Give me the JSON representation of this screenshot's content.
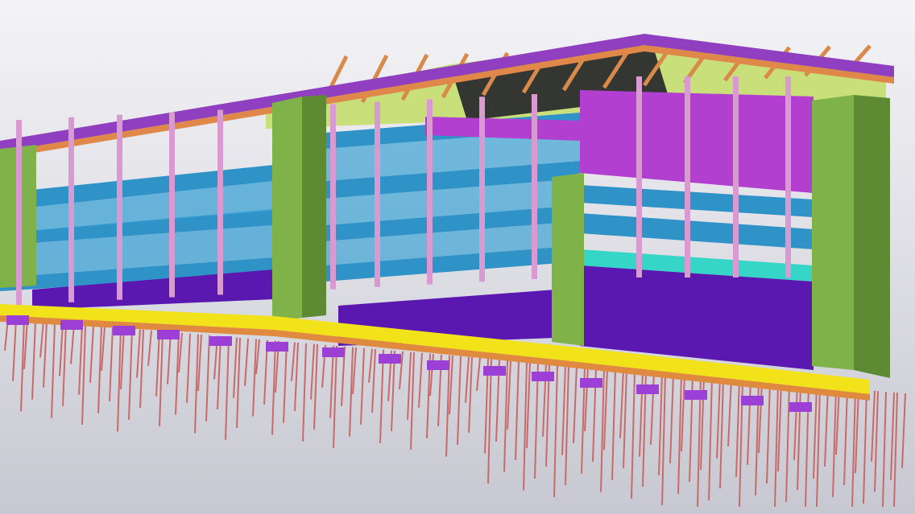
{
  "scene": {
    "subject": "bim-building-model-3d-view",
    "palette": {
      "background_top": "#f2f2f6",
      "background_bottom": "#c9c9d3",
      "floor_slab": "#2f93c8",
      "floor_slab_dark": "#1f6f9e",
      "core_wall": "#7fb34a",
      "core_wall_dark": "#5e8a33",
      "column": "#d89ad0",
      "roof_truss": "#d98a4a",
      "facade_panel": "#b23fd0",
      "ground_wall": "#5a18b0",
      "foundation_beam": "#f2e21a",
      "pile": "#c86a6a",
      "pile_cap": "#9b3fd6",
      "ceiling": "#c8e07a",
      "cyan_beam": "#35d6c8",
      "grey": "#b8b8b8"
    }
  }
}
